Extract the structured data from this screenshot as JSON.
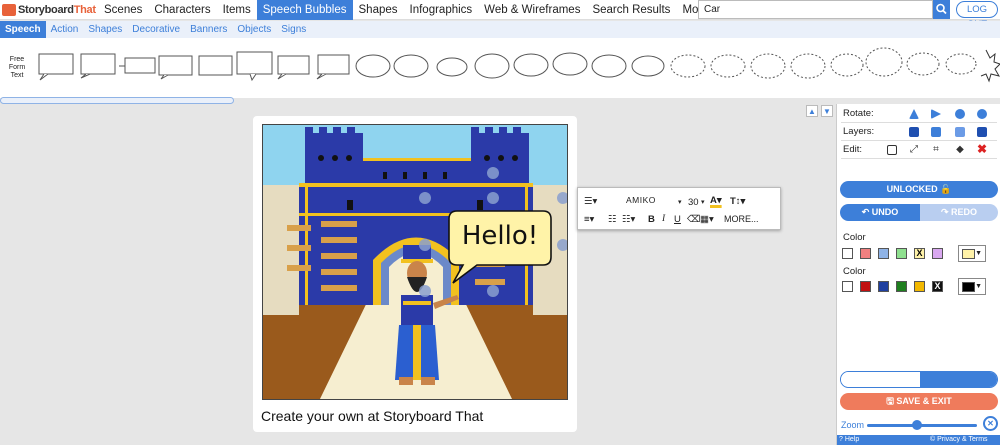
{
  "logo": {
    "text_a": "Storyboard",
    "text_b": "That"
  },
  "nav": {
    "items": [
      "Scenes",
      "Characters",
      "Items",
      "Speech Bubbles",
      "Shapes",
      "Infographics",
      "Web & Wireframes",
      "Search Results",
      "More..."
    ],
    "active": "Speech Bubbles"
  },
  "search": {
    "value": "Car"
  },
  "logout_label": "LOG OUT",
  "subnav": {
    "items": [
      "Speech",
      "Action",
      "Shapes",
      "Decorative",
      "Banners",
      "Objects",
      "Signs"
    ],
    "active": "Speech"
  },
  "bubble_library": {
    "free_form_label": "Free Form Text"
  },
  "scene": {
    "speech_text": "Hello!",
    "cta": "Create your own at Storyboard That"
  },
  "text_toolbar": {
    "font": "AMIKO",
    "size": "30",
    "more_label": "MORE..."
  },
  "panel": {
    "rotate_label": "Rotate:",
    "layers_label": "Layers:",
    "edit_label": "Edit:",
    "unlocked_label": "UNLOCKED",
    "undo_label": "UNDO",
    "redo_label": "REDO",
    "color_label_1": "Color",
    "color_label_2": "Color",
    "swatches_1": [
      "#ffffff",
      "#f08080",
      "#8fb3e6",
      "#8fe08f",
      "#fff2a8",
      "#d9a8f0"
    ],
    "swatches_2": [
      "#ffffff",
      "#c01010",
      "#1f3f9f",
      "#1f7f1f",
      "#f2b800",
      "#111111"
    ],
    "selected_1": "#fff2a8",
    "selected_2": "#000000",
    "save_label": "SAVE & EXIT",
    "zoom_label": "Zoom",
    "help_label": "? Help",
    "privacy_label": "© Privacy & Terms"
  },
  "colors": {
    "accent": "#3d7fd9",
    "save": "#ef7b5c"
  }
}
